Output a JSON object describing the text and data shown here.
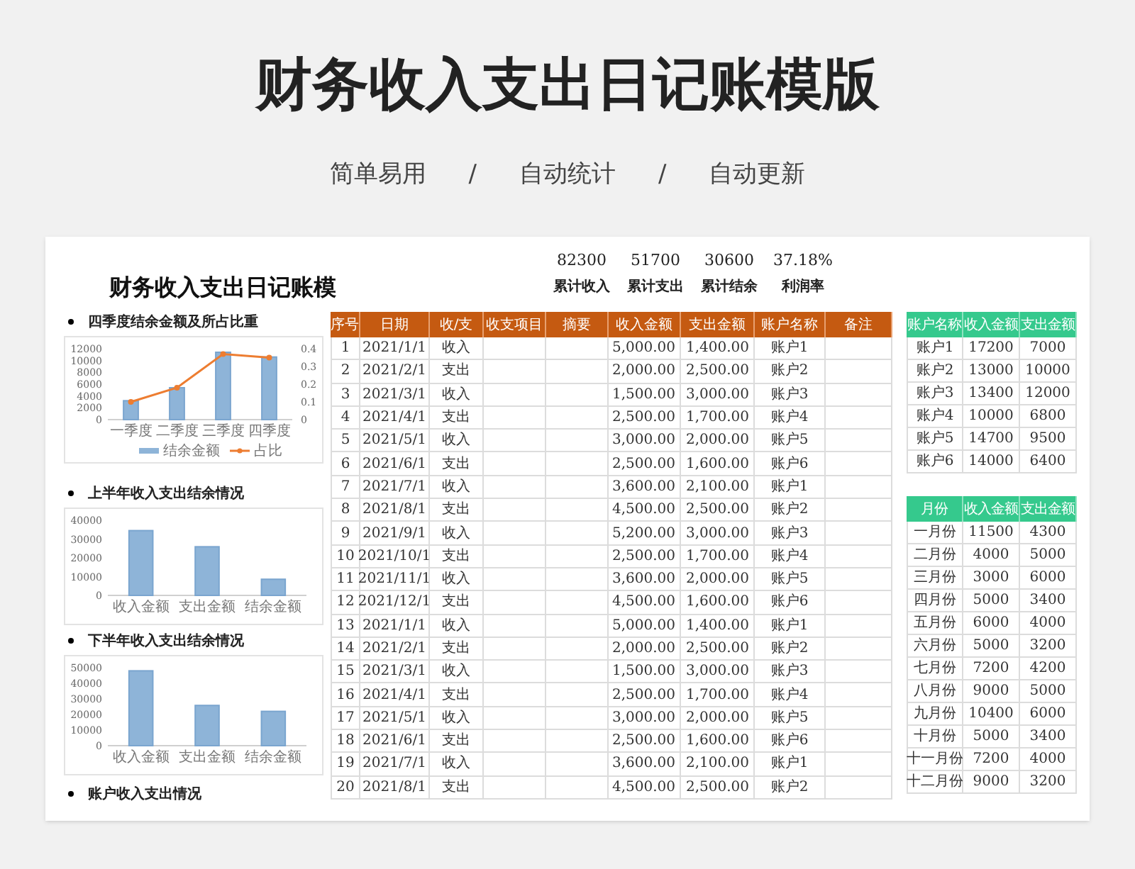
{
  "title": "财务收入支出日记账模版",
  "subtitle": [
    "简单易用",
    "/",
    "自动统计",
    "/",
    "自动更新"
  ],
  "sheet": {
    "title": "财务收入支出日记账模",
    "summary": [
      {
        "value": "82300",
        "label": "累计收入"
      },
      {
        "value": "51700",
        "label": "累计支出"
      },
      {
        "value": "30600",
        "label": "累计结余"
      },
      {
        "value": "37.18%",
        "label": "利润率"
      }
    ],
    "charts": [
      {
        "heading": "四季度结余金额及所占比重",
        "chart_data": {
          "type": "bar",
          "categories": [
            "一季度",
            "二季度",
            "三季度",
            "四季度"
          ],
          "series": [
            {
              "name": "结余金额",
              "type": "bar",
              "color": "#8eb4d8",
              "values": [
                3200,
                5400,
                11400,
                10600
              ]
            },
            {
              "name": "占比",
              "type": "line",
              "color": "#ed7d31",
              "axis": "y2",
              "marker": "circle",
              "values": [
                0.1,
                0.18,
                0.37,
                0.35
              ]
            }
          ],
          "ylim": [
            0,
            12000
          ],
          "yticks": [
            0,
            2000,
            4000,
            6000,
            8000,
            10000,
            12000
          ],
          "legend": "bottom",
          "y2lim": [
            0,
            0.4
          ],
          "y2ticks": [
            0,
            0.1,
            0.2,
            0.3,
            0.4
          ]
        }
      },
      {
        "heading": "上半年收入支出结余情况",
        "chart_data": {
          "type": "bar",
          "categories": [
            "收入金额",
            "支出金额",
            "结余金额"
          ],
          "series": [
            {
              "color": "#8eb4d8",
              "values": [
                34500,
                25900,
                8600
              ]
            }
          ],
          "ylim": [
            0,
            40000
          ],
          "yticks": [
            0,
            10000,
            20000,
            30000,
            40000
          ]
        }
      },
      {
        "heading": "下半年收入支出结余情况",
        "chart_data": {
          "type": "bar",
          "categories": [
            "收入金额",
            "支出金额",
            "结余金额"
          ],
          "series": [
            {
              "color": "#8eb4d8",
              "values": [
                48000,
                25800,
                22000
              ]
            }
          ],
          "ylim": [
            0,
            50000
          ],
          "yticks": [
            0,
            10000,
            20000,
            30000,
            40000,
            50000
          ]
        }
      }
    ],
    "last_heading": "账户收入支出情况",
    "journal": {
      "columns": [
        "序号",
        "日期",
        "收/支",
        "收支项目",
        "摘要",
        "收入金额",
        "支出金额",
        "账户名称",
        "备注"
      ],
      "rows": [
        {
          "no": "1",
          "date": "2021/1/1",
          "type": "收入",
          "income": "5,000.00",
          "expense": "1,400.00",
          "account": "账户1"
        },
        {
          "no": "2",
          "date": "2021/2/1",
          "type": "支出",
          "income": "2,000.00",
          "expense": "2,500.00",
          "account": "账户2"
        },
        {
          "no": "3",
          "date": "2021/3/1",
          "type": "收入",
          "income": "1,500.00",
          "expense": "3,000.00",
          "account": "账户3"
        },
        {
          "no": "4",
          "date": "2021/4/1",
          "type": "支出",
          "income": "2,500.00",
          "expense": "1,700.00",
          "account": "账户4"
        },
        {
          "no": "5",
          "date": "2021/5/1",
          "type": "收入",
          "income": "3,000.00",
          "expense": "2,000.00",
          "account": "账户5"
        },
        {
          "no": "6",
          "date": "2021/6/1",
          "type": "支出",
          "income": "2,500.00",
          "expense": "1,600.00",
          "account": "账户6"
        },
        {
          "no": "7",
          "date": "2021/7/1",
          "type": "收入",
          "income": "3,600.00",
          "expense": "2,100.00",
          "account": "账户1"
        },
        {
          "no": "8",
          "date": "2021/8/1",
          "type": "支出",
          "income": "4,500.00",
          "expense": "2,500.00",
          "account": "账户2"
        },
        {
          "no": "9",
          "date": "2021/9/1",
          "type": "收入",
          "income": "5,200.00",
          "expense": "3,000.00",
          "account": "账户3"
        },
        {
          "no": "10",
          "date": "2021/10/1",
          "type": "支出",
          "income": "2,500.00",
          "expense": "1,700.00",
          "account": "账户4"
        },
        {
          "no": "11",
          "date": "2021/11/1",
          "type": "收入",
          "income": "3,600.00",
          "expense": "2,000.00",
          "account": "账户5"
        },
        {
          "no": "12",
          "date": "2021/12/1",
          "type": "支出",
          "income": "4,500.00",
          "expense": "1,600.00",
          "account": "账户6"
        },
        {
          "no": "13",
          "date": "2021/1/1",
          "type": "收入",
          "income": "5,000.00",
          "expense": "1,400.00",
          "account": "账户1"
        },
        {
          "no": "14",
          "date": "2021/2/1",
          "type": "支出",
          "income": "2,000.00",
          "expense": "2,500.00",
          "account": "账户2"
        },
        {
          "no": "15",
          "date": "2021/3/1",
          "type": "收入",
          "income": "1,500.00",
          "expense": "3,000.00",
          "account": "账户3"
        },
        {
          "no": "16",
          "date": "2021/4/1",
          "type": "支出",
          "income": "2,500.00",
          "expense": "1,700.00",
          "account": "账户4"
        },
        {
          "no": "17",
          "date": "2021/5/1",
          "type": "收入",
          "income": "3,000.00",
          "expense": "2,000.00",
          "account": "账户5"
        },
        {
          "no": "18",
          "date": "2021/6/1",
          "type": "支出",
          "income": "2,500.00",
          "expense": "1,600.00",
          "account": "账户6"
        },
        {
          "no": "19",
          "date": "2021/7/1",
          "type": "收入",
          "income": "3,600.00",
          "expense": "2,100.00",
          "account": "账户1"
        },
        {
          "no": "20",
          "date": "2021/8/1",
          "type": "支出",
          "income": "4,500.00",
          "expense": "2,500.00",
          "account": "账户2"
        }
      ]
    },
    "accounts": {
      "columns": [
        "账户名称",
        "收入金额",
        "支出金额"
      ],
      "rows": [
        [
          "账户1",
          "17200",
          "7000"
        ],
        [
          "账户2",
          "13000",
          "10000"
        ],
        [
          "账户3",
          "13400",
          "12000"
        ],
        [
          "账户4",
          "10000",
          "6800"
        ],
        [
          "账户5",
          "14700",
          "9500"
        ],
        [
          "账户6",
          "14000",
          "6400"
        ]
      ]
    },
    "months": {
      "columns": [
        "月份",
        "收入金额",
        "支出金额"
      ],
      "rows": [
        [
          "一月份",
          "11500",
          "4300"
        ],
        [
          "二月份",
          "4000",
          "5000"
        ],
        [
          "三月份",
          "3000",
          "6000"
        ],
        [
          "四月份",
          "5000",
          "3400"
        ],
        [
          "五月份",
          "6000",
          "4000"
        ],
        [
          "六月份",
          "5000",
          "3200"
        ],
        [
          "七月份",
          "7200",
          "4200"
        ],
        [
          "八月份",
          "9000",
          "5000"
        ],
        [
          "九月份",
          "10400",
          "6000"
        ],
        [
          "十月份",
          "5000",
          "3400"
        ],
        [
          "十一月份",
          "7200",
          "4000"
        ],
        [
          "十二月份",
          "9000",
          "3200"
        ]
      ]
    }
  }
}
